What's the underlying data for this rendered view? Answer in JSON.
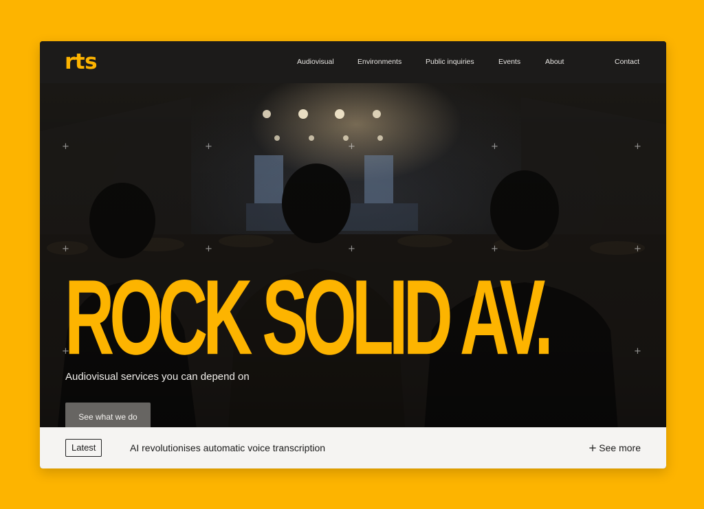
{
  "brand": {
    "logo_text": "rts",
    "accent_color": "#FDB400"
  },
  "nav": {
    "items": [
      {
        "label": "Audiovisual"
      },
      {
        "label": "Environments"
      },
      {
        "label": "Public inquiries"
      },
      {
        "label": "Events"
      },
      {
        "label": "About"
      }
    ],
    "contact_label": "Contact"
  },
  "hero": {
    "headline": "ROCK SOLID AV.",
    "subtitle": "Audiovisual services you can depend on",
    "cta_label": "See what we do",
    "decor_icon": "plus-marker-icon"
  },
  "latest": {
    "badge_label": "Latest",
    "headline": "AI revolutionises automatic voice transcription",
    "see_more_icon": "plus-icon",
    "see_more_label": "See more"
  }
}
